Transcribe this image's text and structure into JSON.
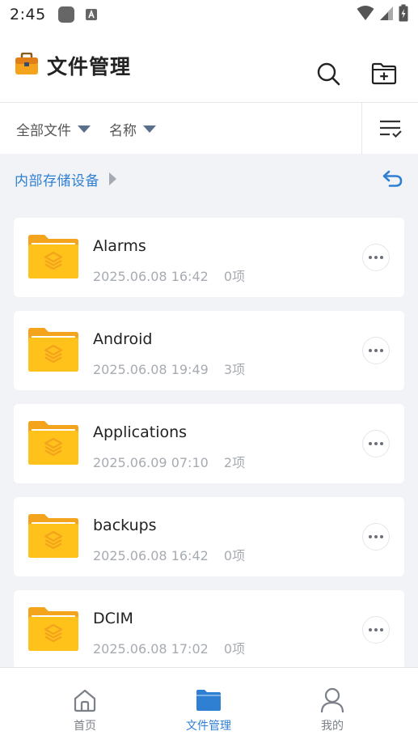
{
  "status_bar": {
    "time": "2:45"
  },
  "header": {
    "title": "文件管理"
  },
  "filters": {
    "scope_label": "全部文件",
    "sort_label": "名称"
  },
  "breadcrumb": {
    "current": "内部存储设备"
  },
  "files": [
    {
      "name": "Alarms",
      "date": "2025.06.08 16:42",
      "count": "0项"
    },
    {
      "name": "Android",
      "date": "2025.06.08 19:49",
      "count": "3项"
    },
    {
      "name": "Applications",
      "date": "2025.06.09 07:10",
      "count": "2项"
    },
    {
      "name": "backups",
      "date": "2025.06.08 16:42",
      "count": "0项"
    },
    {
      "name": "DCIM",
      "date": "2025.06.08 17:02",
      "count": "0项"
    }
  ],
  "nav": {
    "items": [
      {
        "label": "首页",
        "icon": "home-icon"
      },
      {
        "label": "文件管理",
        "icon": "folder-icon"
      },
      {
        "label": "我的",
        "icon": "person-icon"
      }
    ],
    "active_index": 1
  },
  "colors": {
    "accent": "#2f7fd3",
    "folder": "#ffc21a",
    "folder_tab": "#f4a41c",
    "background": "#f2f3f6"
  }
}
